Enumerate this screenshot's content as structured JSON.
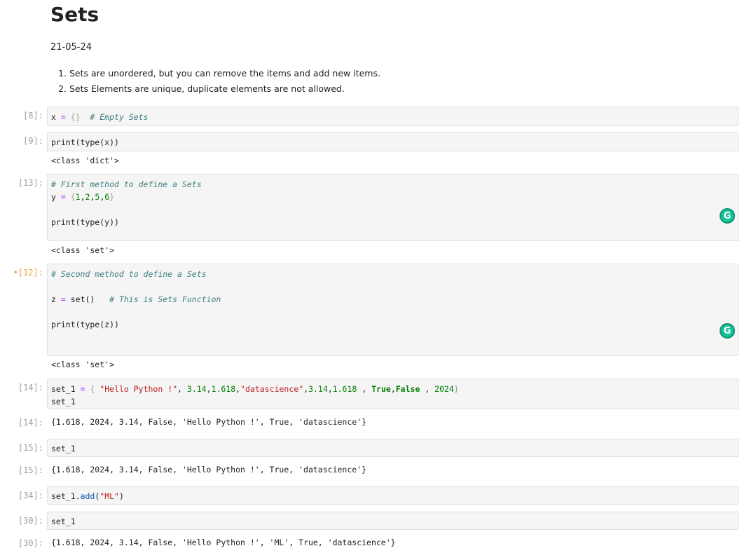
{
  "markdown": {
    "title": "Sets",
    "date": "21-05-24",
    "list": [
      "Sets are unordered, but you can remove the items and add new items.",
      "Sets Elements are unique, duplicate elements are not allowed."
    ]
  },
  "cells": {
    "c8": {
      "prompt": "[8]:",
      "t1": "x ",
      "t2": "=",
      "t3": " {}",
      "t4": "  # Empty Sets"
    },
    "c9": {
      "prompt": "[9]:",
      "line": "print(type(x))",
      "out": "<class 'dict'>"
    },
    "c13": {
      "prompt": "[13]:",
      "l1": "# First method to define a Sets",
      "l2a": "y ",
      "l2b": "=",
      "l2c": " {",
      "l2d": "1",
      "l2e": ",",
      "l2f": "2",
      "l2g": ",",
      "l2h": "5",
      "l2i": ",",
      "l2j": "6",
      "l2k": "}",
      "l3": "print(type(y))",
      "out": "<class 'set'>"
    },
    "c12": {
      "prompt": "•[12]:",
      "l1": "# Second method to define a Sets",
      "l2a": "z ",
      "l2b": "=",
      "l2c": " set()   ",
      "l2d": "# This is Sets Function",
      "l3": "print(type(z))",
      "out": "<class 'set'>"
    },
    "c14": {
      "prompt": "[14]:",
      "a": "set_1 ",
      "b": "=",
      "c": " { ",
      "d": "\"Hello Python !\"",
      "e": ", ",
      "f": "3.14",
      "g": ",",
      "h": "1.618",
      "i": ",",
      "j": "\"datascience\"",
      "k": ",",
      "l": "3.14",
      "m": ",",
      "n": "1.618",
      "o": " , ",
      "p": "True",
      "q": ",",
      "r": "False",
      "s": " , ",
      "t": "2024",
      "u": "}",
      "line2": "set_1",
      "out_prompt": "[14]:",
      "out": "{1.618, 2024, 3.14, False, 'Hello Python !', True, 'datascience'}"
    },
    "c15": {
      "prompt": "[15]:",
      "line": "set_1",
      "out_prompt": "[15]:",
      "out": "{1.618, 2024, 3.14, False, 'Hello Python !', True, 'datascience'}"
    },
    "c34": {
      "prompt": "[34]:",
      "a": "set_1.",
      "b": "add",
      "c": "(",
      "d": "\"ML\"",
      "e": ")"
    },
    "c30": {
      "prompt": "[30]:",
      "line": "set_1",
      "out_prompt": "[30]:",
      "out": "{1.618, 2024, 3.14, False, 'Hello Python !', 'ML', True, 'datascience'}"
    }
  },
  "grammarly": {
    "letter": "G",
    "color": "#15c39a"
  }
}
